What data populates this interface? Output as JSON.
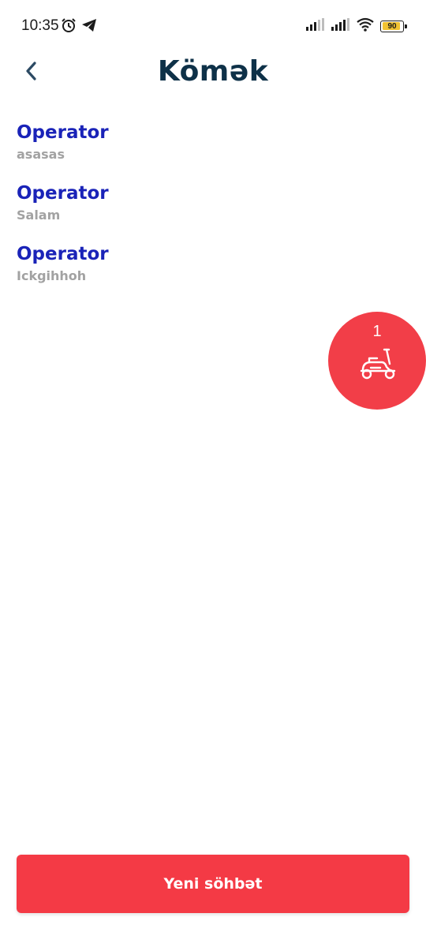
{
  "status_bar": {
    "time": "10:35",
    "battery_level": "90",
    "battery_fraction": 0.9,
    "battery_color": "#f1c232",
    "icons": [
      "alarm-icon",
      "telegram-icon",
      "signal-icon",
      "signal-icon",
      "wifi-icon",
      "battery-icon"
    ]
  },
  "header": {
    "title": "Kömək",
    "back_icon": "chevron-left-icon"
  },
  "chats": [
    {
      "sender": "Operator",
      "preview": "asasas"
    },
    {
      "sender": "Operator",
      "preview": "Salam"
    },
    {
      "sender": "Operator",
      "preview": "Ickgihhoh"
    }
  ],
  "courier_badge": {
    "count": "1",
    "icon": "scooter-icon",
    "color": "#f23e48"
  },
  "footer": {
    "new_chat_label": "Yeni söhbət",
    "button_color": "#f43a45"
  }
}
